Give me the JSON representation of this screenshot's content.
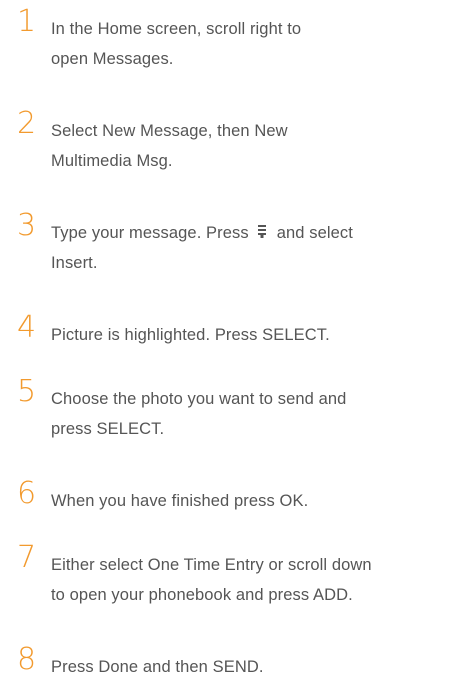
{
  "steps": [
    {
      "number": "1",
      "lines": [
        "In the Home screen, scroll right to",
        "open Messages."
      ]
    },
    {
      "number": "2",
      "lines": [
        "Select New Message, then New",
        "Multimedia Msg."
      ]
    },
    {
      "number": "3",
      "line1_before": "Type your message. Press",
      "line1_after": "and select",
      "lines": [
        "Insert."
      ],
      "icon": "menu-icon"
    },
    {
      "number": "4",
      "lines": [
        "Picture is highlighted. Press SELECT."
      ]
    },
    {
      "number": "5",
      "lines": [
        "Choose the photo you want to send and",
        "press SELECT."
      ]
    },
    {
      "number": "6",
      "lines": [
        "When you have finished press OK."
      ]
    },
    {
      "number": "7",
      "lines": [
        "Either select One Time Entry or scroll down",
        "to open your phonebook and press ADD."
      ]
    },
    {
      "number": "8",
      "lines": [
        "Press Done and then SEND."
      ]
    }
  ],
  "colors": {
    "accent": "#f29a2e",
    "text": "#555555"
  }
}
